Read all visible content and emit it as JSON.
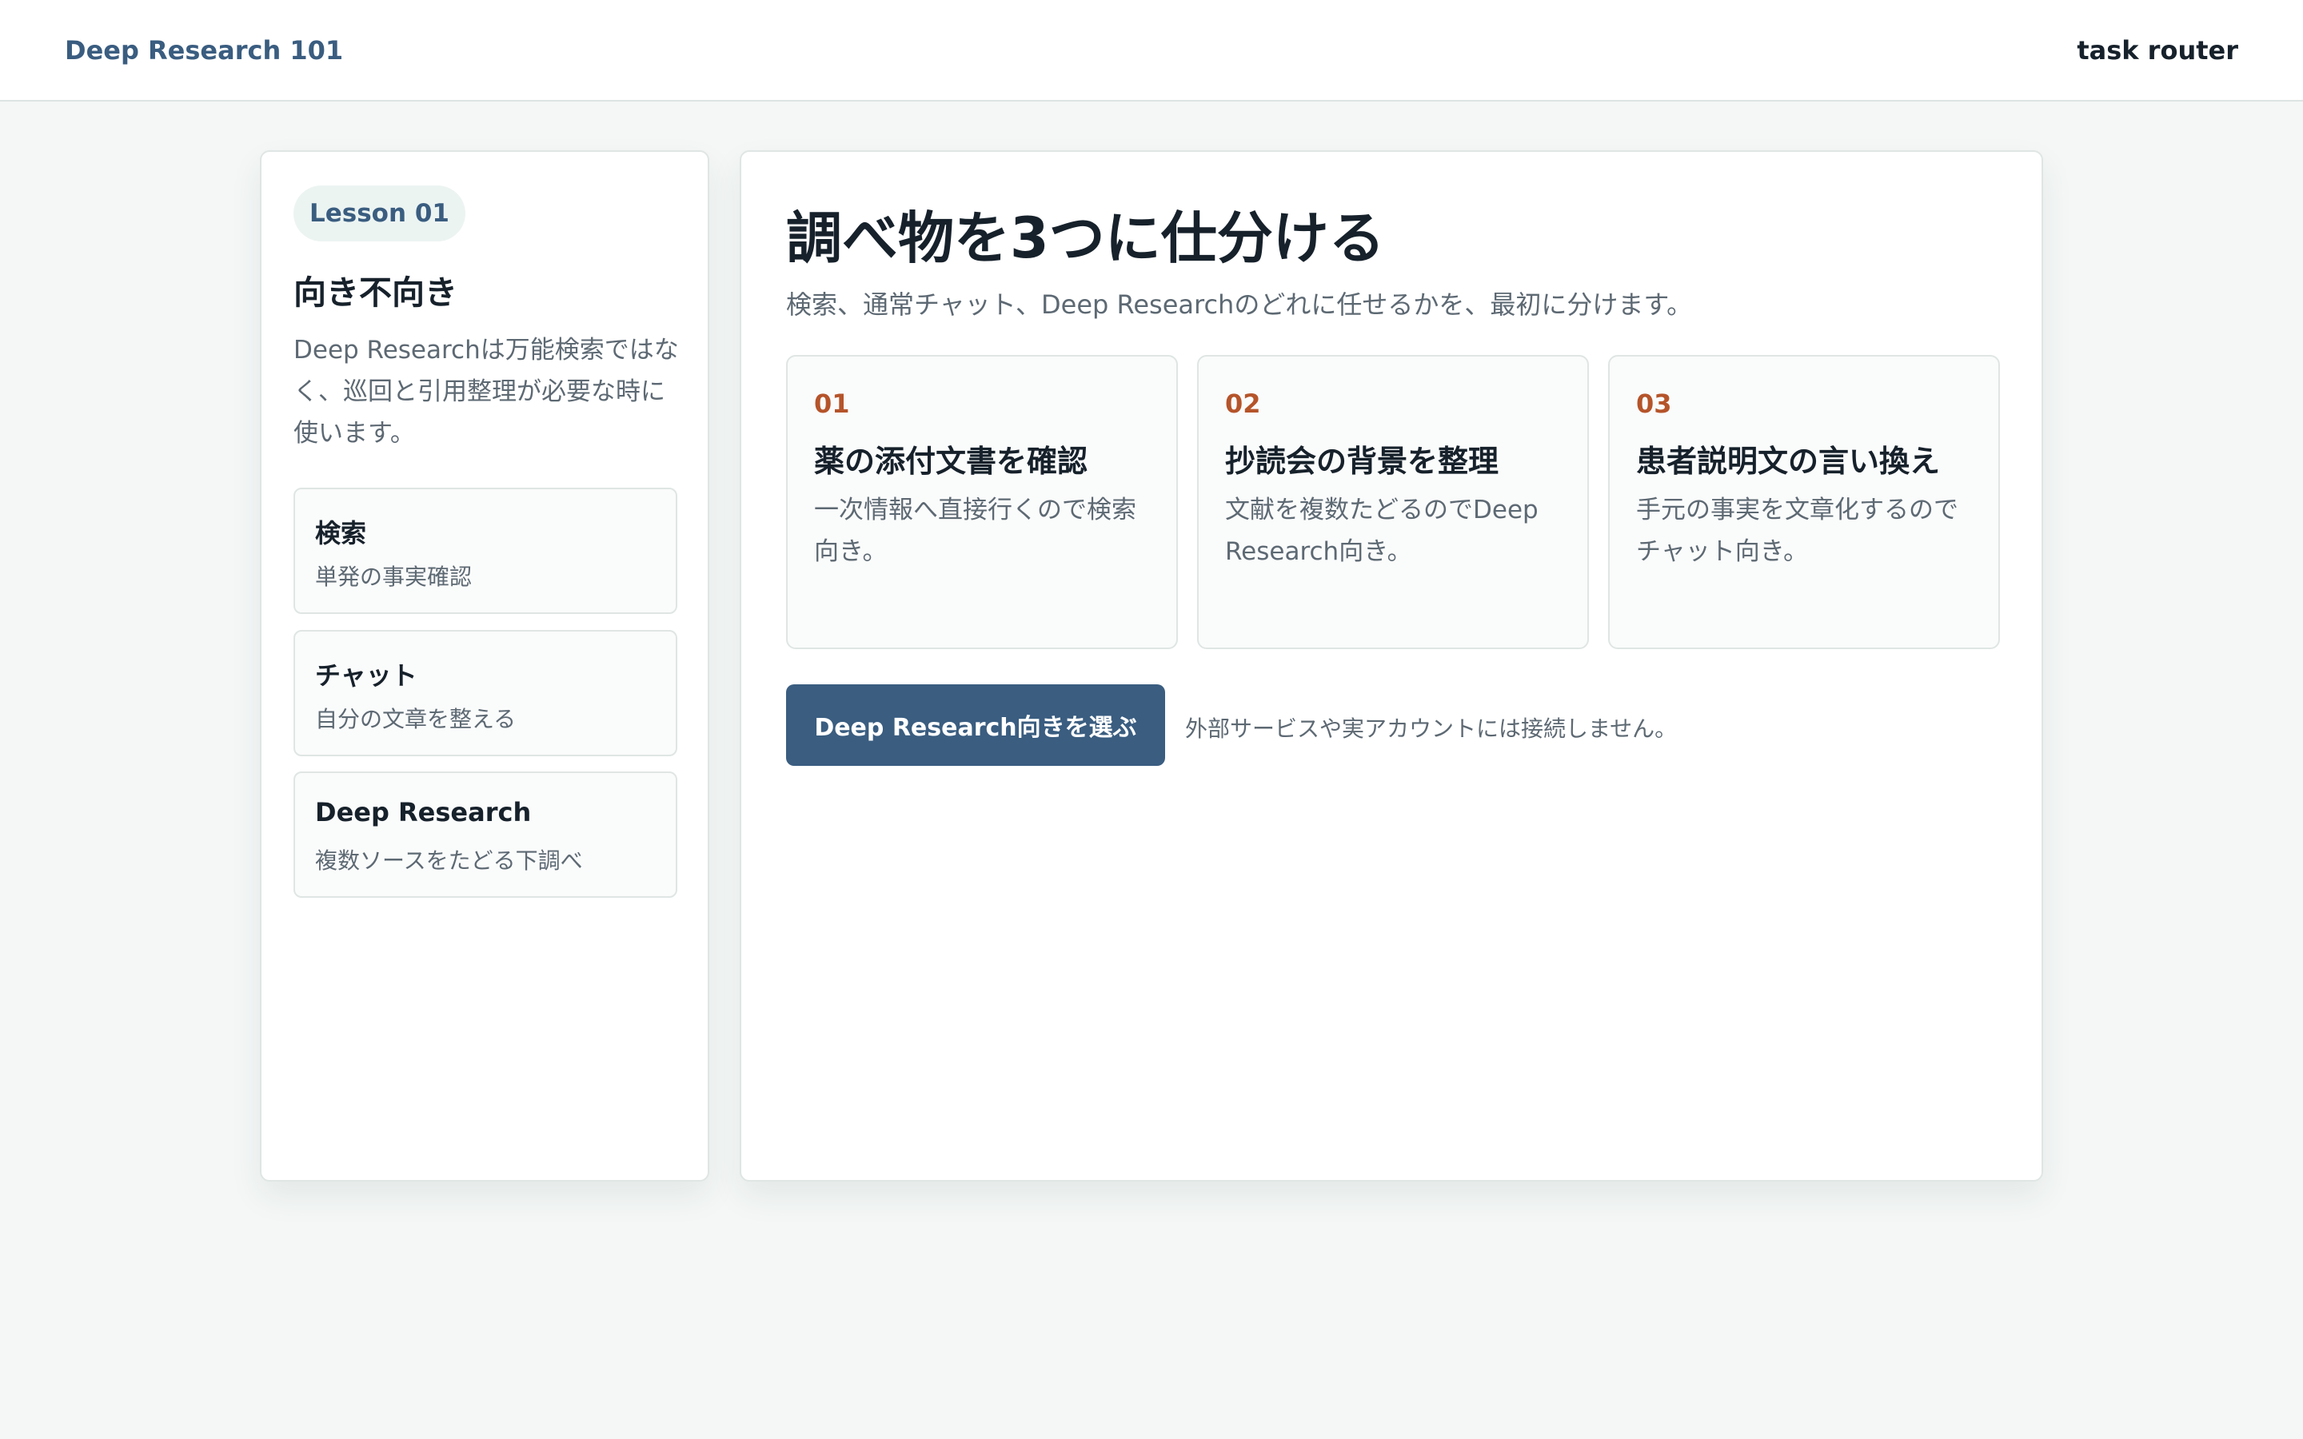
{
  "header": {
    "brand": "Deep Research 101",
    "right_label": "task router"
  },
  "sidebar": {
    "lesson_badge": "Lesson 01",
    "title": "向き不向き",
    "description": "Deep Researchは万能検索ではなく、巡回と引用整理が必要な時に使います。",
    "modes": [
      {
        "title": "検索",
        "subtitle": "単発の事実確認"
      },
      {
        "title": "チャット",
        "subtitle": "自分の文章を整える"
      },
      {
        "title": "Deep Research",
        "subtitle": "複数ソースをたどる下調べ"
      }
    ]
  },
  "main": {
    "title": "調べ物を3つに仕分ける",
    "subtitle": "検索、通常チャット、Deep Researchのどれに任せるかを、最初に分けます。",
    "tasks": [
      {
        "number": "01",
        "title": "薬の添付文書を確認",
        "description": "一次情報へ直接行くので検索向き。"
      },
      {
        "number": "02",
        "title": "抄読会の背景を整理",
        "description": "文献を複数たどるのでDeep Research向き。"
      },
      {
        "number": "03",
        "title": "患者説明文の言い換え",
        "description": "手元の事実を文章化するのでチャット向き。"
      }
    ],
    "select_button": "Deep Research向きを選ぶ",
    "note": "外部サービスや実アカウントには接続しません。"
  },
  "colors": {
    "accent": "#3a5d80",
    "number_accent": "#b5542a",
    "background": "#f4f7f6"
  }
}
